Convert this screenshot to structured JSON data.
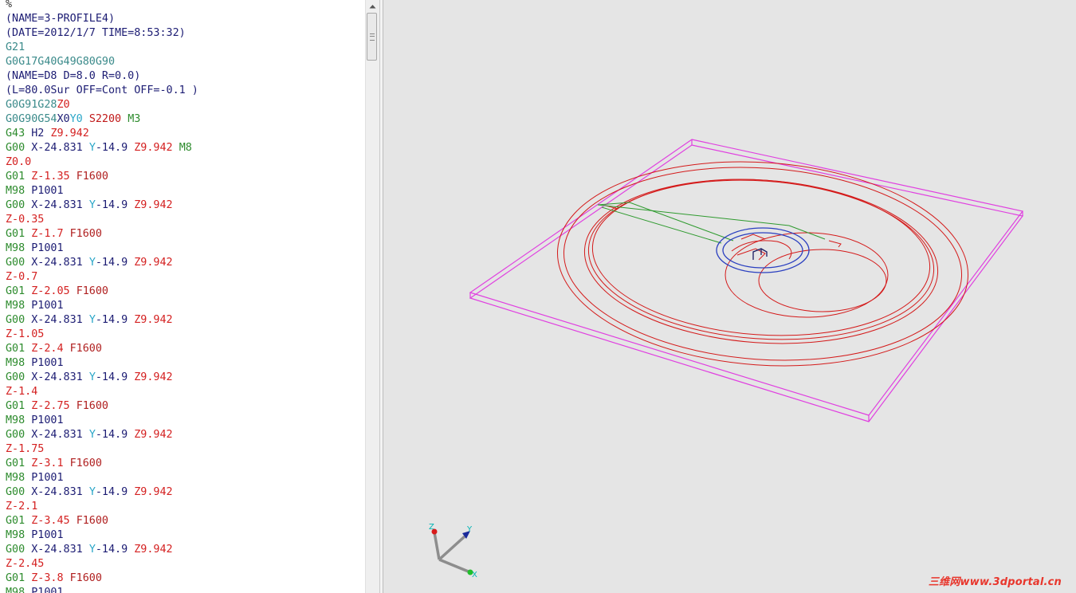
{
  "editor": {
    "lines": [
      [
        {
          "t": "%",
          "c": "pct"
        }
      ],
      [
        {
          "t": "(NAME=3-PROFILE4)",
          "c": "cmt"
        }
      ],
      [
        {
          "t": "(DATE=2012/1/7 TIME=8:53:32)",
          "c": "cmt"
        }
      ],
      [
        {
          "t": "G21",
          "c": "gcode"
        }
      ],
      [
        {
          "t": "G0G17G40G49G80G90",
          "c": "gcode"
        }
      ],
      [
        {
          "t": "(NAME=D8 D=8.0 R=0.0)",
          "c": "cmt"
        }
      ],
      [
        {
          "t": "(L=80.0Sur OFF=Cont OFF=-0.1 )",
          "c": "cmt"
        }
      ],
      [
        {
          "t": "G0G91G28",
          "c": "gcode"
        },
        {
          "t": "Z0",
          "c": "z"
        }
      ],
      [
        {
          "t": "G0G90G54",
          "c": "gcode"
        },
        {
          "t": "X0",
          "c": "x"
        },
        {
          "t": "Y0 ",
          "c": "y"
        },
        {
          "t": "S2200 ",
          "c": "s"
        },
        {
          "t": "M3",
          "c": "m"
        }
      ],
      [
        {
          "t": "G43 ",
          "c": "g1"
        },
        {
          "t": "H2 ",
          "c": "h"
        },
        {
          "t": "Z9.942",
          "c": "z"
        }
      ],
      [
        {
          "t": "G00 ",
          "c": "g1"
        },
        {
          "t": "X-24.831 ",
          "c": "x"
        },
        {
          "t": "Y",
          "c": "y"
        },
        {
          "t": "-14.9 ",
          "c": "x"
        },
        {
          "t": "Z9.942 ",
          "c": "z"
        },
        {
          "t": "M8",
          "c": "m"
        }
      ],
      [
        {
          "t": "Z0.0",
          "c": "z"
        }
      ],
      [
        {
          "t": "G01 ",
          "c": "g1"
        },
        {
          "t": "Z-1.35 ",
          "c": "z"
        },
        {
          "t": "F1600",
          "c": "f"
        }
      ],
      [
        {
          "t": "M98 ",
          "c": "m"
        },
        {
          "t": "P1001",
          "c": "p"
        }
      ],
      [
        {
          "t": "G00 ",
          "c": "g1"
        },
        {
          "t": "X-24.831 ",
          "c": "x"
        },
        {
          "t": "Y",
          "c": "y"
        },
        {
          "t": "-14.9 ",
          "c": "x"
        },
        {
          "t": "Z9.942",
          "c": "z"
        }
      ],
      [
        {
          "t": "Z-0.35",
          "c": "z"
        }
      ],
      [
        {
          "t": "G01 ",
          "c": "g1"
        },
        {
          "t": "Z-1.7 ",
          "c": "z"
        },
        {
          "t": "F1600",
          "c": "f"
        }
      ],
      [
        {
          "t": "M98 ",
          "c": "m"
        },
        {
          "t": "P1001",
          "c": "p"
        }
      ],
      [
        {
          "t": "G00 ",
          "c": "g1"
        },
        {
          "t": "X-24.831 ",
          "c": "x"
        },
        {
          "t": "Y",
          "c": "y"
        },
        {
          "t": "-14.9 ",
          "c": "x"
        },
        {
          "t": "Z9.942",
          "c": "z"
        }
      ],
      [
        {
          "t": "Z-0.7",
          "c": "z"
        }
      ],
      [
        {
          "t": "G01 ",
          "c": "g1"
        },
        {
          "t": "Z-2.05 ",
          "c": "z"
        },
        {
          "t": "F1600",
          "c": "f"
        }
      ],
      [
        {
          "t": "M98 ",
          "c": "m"
        },
        {
          "t": "P1001",
          "c": "p"
        }
      ],
      [
        {
          "t": "G00 ",
          "c": "g1"
        },
        {
          "t": "X-24.831 ",
          "c": "x"
        },
        {
          "t": "Y",
          "c": "y"
        },
        {
          "t": "-14.9 ",
          "c": "x"
        },
        {
          "t": "Z9.942",
          "c": "z"
        }
      ],
      [
        {
          "t": "Z-1.05",
          "c": "z"
        }
      ],
      [
        {
          "t": "G01 ",
          "c": "g1"
        },
        {
          "t": "Z-2.4 ",
          "c": "z"
        },
        {
          "t": "F1600",
          "c": "f"
        }
      ],
      [
        {
          "t": "M98 ",
          "c": "m"
        },
        {
          "t": "P1001",
          "c": "p"
        }
      ],
      [
        {
          "t": "G00 ",
          "c": "g1"
        },
        {
          "t": "X-24.831 ",
          "c": "x"
        },
        {
          "t": "Y",
          "c": "y"
        },
        {
          "t": "-14.9 ",
          "c": "x"
        },
        {
          "t": "Z9.942",
          "c": "z"
        }
      ],
      [
        {
          "t": "Z-1.4",
          "c": "z"
        }
      ],
      [
        {
          "t": "G01 ",
          "c": "g1"
        },
        {
          "t": "Z-2.75 ",
          "c": "z"
        },
        {
          "t": "F1600",
          "c": "f"
        }
      ],
      [
        {
          "t": "M98 ",
          "c": "m"
        },
        {
          "t": "P1001",
          "c": "p"
        }
      ],
      [
        {
          "t": "G00 ",
          "c": "g1"
        },
        {
          "t": "X-24.831 ",
          "c": "x"
        },
        {
          "t": "Y",
          "c": "y"
        },
        {
          "t": "-14.9 ",
          "c": "x"
        },
        {
          "t": "Z9.942",
          "c": "z"
        }
      ],
      [
        {
          "t": "Z-1.75",
          "c": "z"
        }
      ],
      [
        {
          "t": "G01 ",
          "c": "g1"
        },
        {
          "t": "Z-3.1 ",
          "c": "z"
        },
        {
          "t": "F1600",
          "c": "f"
        }
      ],
      [
        {
          "t": "M98 ",
          "c": "m"
        },
        {
          "t": "P1001",
          "c": "p"
        }
      ],
      [
        {
          "t": "G00 ",
          "c": "g1"
        },
        {
          "t": "X-24.831 ",
          "c": "x"
        },
        {
          "t": "Y",
          "c": "y"
        },
        {
          "t": "-14.9 ",
          "c": "x"
        },
        {
          "t": "Z9.942",
          "c": "z"
        }
      ],
      [
        {
          "t": "Z-2.1",
          "c": "z"
        }
      ],
      [
        {
          "t": "G01 ",
          "c": "g1"
        },
        {
          "t": "Z-3.45 ",
          "c": "z"
        },
        {
          "t": "F1600",
          "c": "f"
        }
      ],
      [
        {
          "t": "M98 ",
          "c": "m"
        },
        {
          "t": "P1001",
          "c": "p"
        }
      ],
      [
        {
          "t": "G00 ",
          "c": "g1"
        },
        {
          "t": "X-24.831 ",
          "c": "x"
        },
        {
          "t": "Y",
          "c": "y"
        },
        {
          "t": "-14.9 ",
          "c": "x"
        },
        {
          "t": "Z9.942",
          "c": "z"
        }
      ],
      [
        {
          "t": "Z-2.45",
          "c": "z"
        }
      ],
      [
        {
          "t": "G01 ",
          "c": "g1"
        },
        {
          "t": "Z-3.8 ",
          "c": "z"
        },
        {
          "t": "F1600",
          "c": "f"
        }
      ],
      [
        {
          "t": "M98 ",
          "c": "m"
        },
        {
          "t": "P1001",
          "c": "p"
        }
      ]
    ]
  },
  "viewport": {
    "background": "#e5e5e5",
    "stock_color": "#e040e0",
    "cut_path_color": "#d41a1a",
    "rapid_path_color": "#2e9a2e",
    "tool_color": "#2a3fc0",
    "axis_triad": {
      "x_label": "X",
      "y_label": "Y",
      "z_label": "Z"
    },
    "watermark": "三维网www.3dportal.cn"
  },
  "colors": {
    "comment": "#1c1c73",
    "gcode": "#3a8a8a",
    "motion": "#2d8b2d",
    "z_word": "#d42020",
    "y_word": "#2aa6c8"
  }
}
